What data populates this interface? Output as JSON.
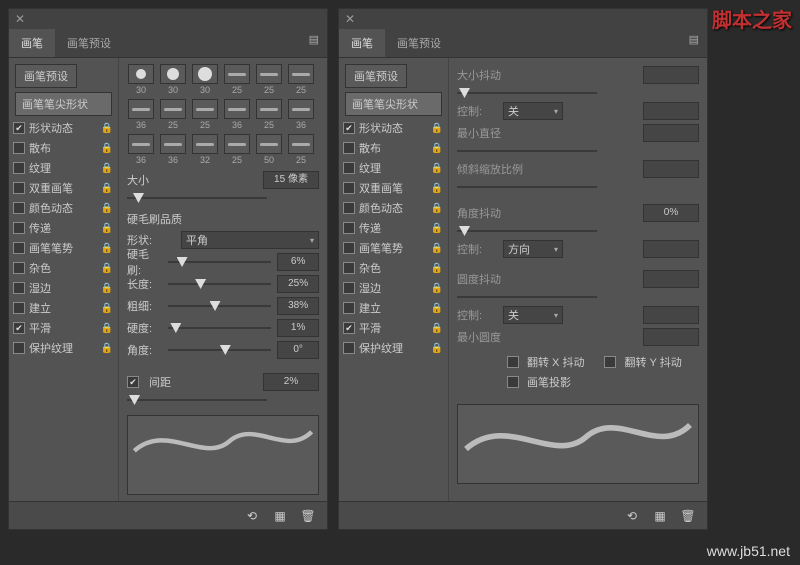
{
  "watermark": {
    "brand": "脚本之家",
    "url": "www.jb51.net"
  },
  "tabs": {
    "brush": "画笔",
    "preset": "画笔预设"
  },
  "sidebar": {
    "presetBtn": "画笔预设",
    "tipShape": "画笔笔尖形状",
    "items": [
      {
        "label": "形状动态",
        "checked": true,
        "lock": true
      },
      {
        "label": "散布",
        "checked": false,
        "lock": true
      },
      {
        "label": "纹理",
        "checked": false,
        "lock": true
      },
      {
        "label": "双重画笔",
        "checked": false,
        "lock": true
      },
      {
        "label": "颜色动态",
        "checked": false,
        "lock": true
      },
      {
        "label": "传递",
        "checked": false,
        "lock": true
      },
      {
        "label": "画笔笔势",
        "checked": false,
        "lock": true
      },
      {
        "label": "杂色",
        "checked": false,
        "lock": true
      },
      {
        "label": "湿边",
        "checked": false,
        "lock": true
      },
      {
        "label": "建立",
        "checked": false,
        "lock": true
      },
      {
        "label": "平滑",
        "checked": true,
        "lock": true
      },
      {
        "label": "保护纹理",
        "checked": false,
        "lock": true
      }
    ]
  },
  "left": {
    "thumbs": [
      {
        "n": "30",
        "t": "dot",
        "s": 10
      },
      {
        "n": "30",
        "t": "dot",
        "s": 12
      },
      {
        "n": "30",
        "t": "dot",
        "s": 14
      },
      {
        "n": "25",
        "t": "line"
      },
      {
        "n": "25",
        "t": "line"
      },
      {
        "n": "25",
        "t": "line"
      },
      {
        "n": "36",
        "t": "line"
      },
      {
        "n": "25",
        "t": "line"
      },
      {
        "n": "25",
        "t": "line"
      },
      {
        "n": "36",
        "t": "line"
      },
      {
        "n": "25",
        "t": "line"
      },
      {
        "n": "36",
        "t": "line"
      },
      {
        "n": "36",
        "t": "line"
      },
      {
        "n": "36",
        "t": "line"
      },
      {
        "n": "32",
        "t": "line"
      },
      {
        "n": "25",
        "t": "line"
      },
      {
        "n": "50",
        "t": "line"
      },
      {
        "n": "25",
        "t": "line"
      }
    ],
    "sizeLabel": "大小",
    "sizeVal": "15 像素",
    "quality": "硬毛刷品质",
    "shapeLabel": "形状:",
    "shapeVal": "平角",
    "rows": [
      {
        "label": "硬毛刷:",
        "val": "6%",
        "pos": 8
      },
      {
        "label": "长度:",
        "val": "25%",
        "pos": 26
      },
      {
        "label": "粗细:",
        "val": "38%",
        "pos": 40
      },
      {
        "label": "硬度:",
        "val": "1%",
        "pos": 2
      },
      {
        "label": "角度:",
        "val": "0°",
        "pos": 50
      }
    ],
    "spacingLabel": "间距",
    "spacingVal": "2%"
  },
  "right": {
    "groups": {
      "sizeJitter": "大小抖动",
      "control": "控制:",
      "controlVal": "关",
      "minDia": "最小直径",
      "tiltScale": "倾斜缩放比例",
      "angleJitter": "角度抖动",
      "angleJitterVal": "0%",
      "control2Val": "方向",
      "roundJitter": "圆度抖动",
      "control3Val": "关",
      "minRound": "最小圆度",
      "flipX": "翻转 X 抖动",
      "flipY": "翻转 Y 抖动",
      "brushProj": "画笔投影"
    }
  },
  "footer": {
    "i1": "⟲",
    "i2": "▦",
    "i3": "🗑"
  }
}
